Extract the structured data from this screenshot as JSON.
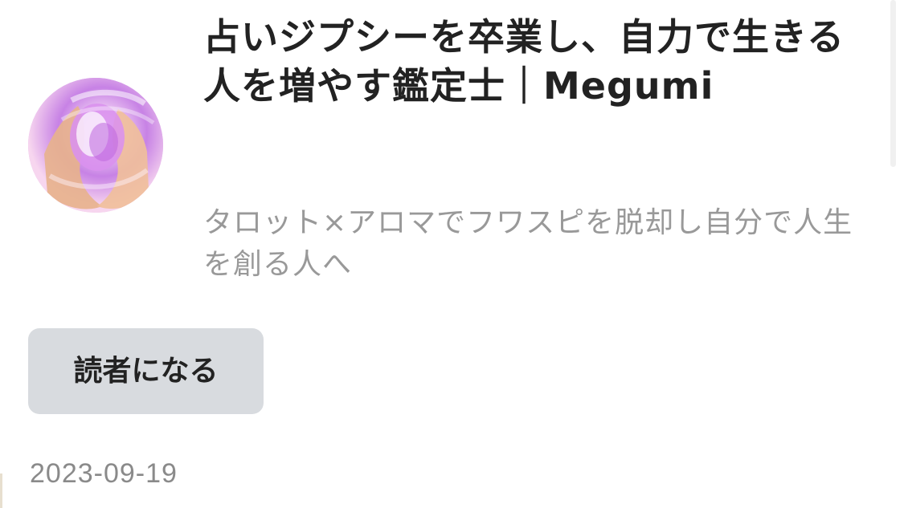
{
  "profile": {
    "title": "占いジプシーを卒業し、自力で生きる人を増やす鑑定士｜Megumi",
    "description": "タロット×アロマでフワスピを脱却し自分で人生を創る人へ",
    "follow_button_label": "読者になる",
    "date": "2023-09-19"
  },
  "colors": {
    "button_background": "#d8dbdf",
    "title_text": "#222222",
    "secondary_text": "#999999"
  },
  "icons": {
    "avatar": "hands-holding-pink-flower"
  }
}
